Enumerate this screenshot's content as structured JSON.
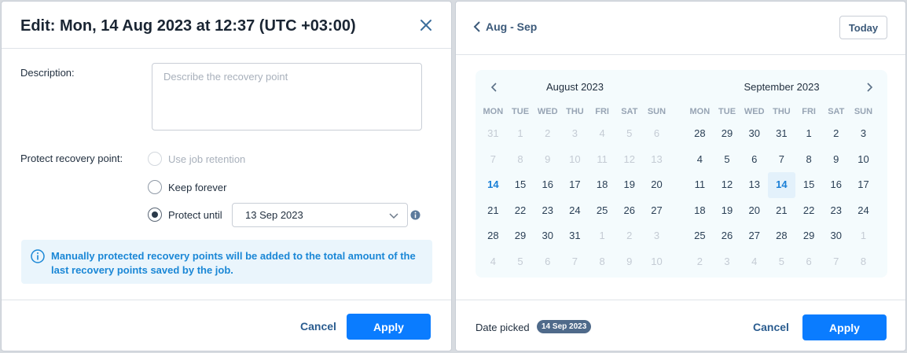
{
  "edit_dialog": {
    "title": "Edit: Mon, 14 Aug 2023 at 12:37 (UTC +03:00)",
    "close_icon": "close-icon",
    "description": {
      "label": "Description:",
      "placeholder": "Describe the recovery point",
      "value": ""
    },
    "protect": {
      "label": "Protect recovery point:",
      "options": [
        {
          "label": "Use job retention",
          "disabled": true,
          "selected": false
        },
        {
          "label": "Keep forever",
          "disabled": false,
          "selected": false
        },
        {
          "label": "Protect until",
          "disabled": false,
          "selected": true
        }
      ],
      "date_value": "13 Sep 2023"
    },
    "notice": "Manually protected recovery points will be added to the total amount of the last recovery points saved by the job.",
    "cancel_label": "Cancel",
    "apply_label": "Apply"
  },
  "date_picker": {
    "range_label": "Aug - Sep",
    "today_label": "Today",
    "weekdays": [
      "MON",
      "TUE",
      "WED",
      "THU",
      "FRI",
      "SAT",
      "SUN"
    ],
    "months": [
      {
        "title": "August 2023",
        "days": [
          {
            "d": "31",
            "muted": true
          },
          {
            "d": "1",
            "muted": true
          },
          {
            "d": "2",
            "muted": true
          },
          {
            "d": "3",
            "muted": true
          },
          {
            "d": "4",
            "muted": true
          },
          {
            "d": "5",
            "muted": true
          },
          {
            "d": "6",
            "muted": true
          },
          {
            "d": "7",
            "muted": true
          },
          {
            "d": "8",
            "muted": true
          },
          {
            "d": "9",
            "muted": true
          },
          {
            "d": "10",
            "muted": true
          },
          {
            "d": "11",
            "muted": true
          },
          {
            "d": "12",
            "muted": true
          },
          {
            "d": "13",
            "muted": true
          },
          {
            "d": "14",
            "today": true
          },
          {
            "d": "15"
          },
          {
            "d": "16"
          },
          {
            "d": "17"
          },
          {
            "d": "18"
          },
          {
            "d": "19"
          },
          {
            "d": "20"
          },
          {
            "d": "21"
          },
          {
            "d": "22"
          },
          {
            "d": "23"
          },
          {
            "d": "24"
          },
          {
            "d": "25"
          },
          {
            "d": "26"
          },
          {
            "d": "27"
          },
          {
            "d": "28"
          },
          {
            "d": "29"
          },
          {
            "d": "30"
          },
          {
            "d": "31"
          },
          {
            "d": "1",
            "muted": true
          },
          {
            "d": "2",
            "muted": true
          },
          {
            "d": "3",
            "muted": true
          },
          {
            "d": "4",
            "muted": true
          },
          {
            "d": "5",
            "muted": true
          },
          {
            "d": "6",
            "muted": true
          },
          {
            "d": "7",
            "muted": true
          },
          {
            "d": "8",
            "muted": true
          },
          {
            "d": "9",
            "muted": true
          },
          {
            "d": "10",
            "muted": true
          }
        ]
      },
      {
        "title": "September 2023",
        "days": [
          {
            "d": "28",
            "muted": false
          },
          {
            "d": "29"
          },
          {
            "d": "30"
          },
          {
            "d": "31"
          },
          {
            "d": "1"
          },
          {
            "d": "2"
          },
          {
            "d": "3"
          },
          {
            "d": "4"
          },
          {
            "d": "5"
          },
          {
            "d": "6"
          },
          {
            "d": "7"
          },
          {
            "d": "8"
          },
          {
            "d": "9"
          },
          {
            "d": "10"
          },
          {
            "d": "11"
          },
          {
            "d": "12"
          },
          {
            "d": "13"
          },
          {
            "d": "14",
            "selected": true
          },
          {
            "d": "15"
          },
          {
            "d": "16"
          },
          {
            "d": "17"
          },
          {
            "d": "18"
          },
          {
            "d": "19"
          },
          {
            "d": "20"
          },
          {
            "d": "21"
          },
          {
            "d": "22"
          },
          {
            "d": "23"
          },
          {
            "d": "24"
          },
          {
            "d": "25"
          },
          {
            "d": "26"
          },
          {
            "d": "27"
          },
          {
            "d": "28"
          },
          {
            "d": "29"
          },
          {
            "d": "30"
          },
          {
            "d": "1",
            "muted": true
          },
          {
            "d": "2",
            "muted": true
          },
          {
            "d": "3",
            "muted": true
          },
          {
            "d": "4",
            "muted": true
          },
          {
            "d": "5",
            "muted": true
          },
          {
            "d": "6",
            "muted": true
          },
          {
            "d": "7",
            "muted": true
          },
          {
            "d": "8",
            "muted": true
          }
        ]
      }
    ],
    "picked_label": "Date picked",
    "picked_value": "14 Sep 2023",
    "cancel_label": "Cancel",
    "apply_label": "Apply"
  },
  "colors": {
    "accent": "#0a7cff",
    "notice_bg": "#eaf5fc",
    "notice_text": "#1a87d6",
    "badge": "#4f6a8a"
  }
}
